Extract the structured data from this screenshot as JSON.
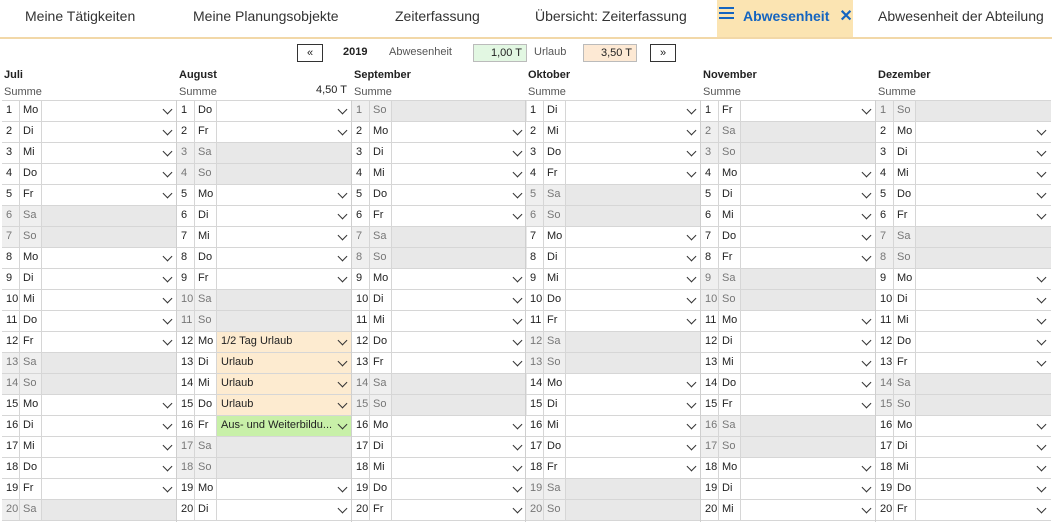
{
  "tabs": [
    {
      "label": "Meine Tätigkeiten"
    },
    {
      "label": "Meine Planungsobjekte"
    },
    {
      "label": "Zeiterfassung"
    },
    {
      "label": "Übersicht: Zeiterfassung"
    },
    {
      "label": "Abwesenheit",
      "active": true
    },
    {
      "label": "Abwesenheit der Abteilung"
    }
  ],
  "controls": {
    "prev": "«",
    "year": "2019",
    "abwesenheit_label": "Abwesenheit",
    "abwesenheit_value": "1,00 T",
    "urlaub_label": "Urlaub",
    "urlaub_value": "3,50 T",
    "next": "»"
  },
  "colors": {
    "accent": "#1565c0",
    "tab_active_bg": "#fbe4b2",
    "urlaub_bg": "#fdebd0",
    "weiter_bg": "#c8f0a8",
    "abw_box": "#e2f7e2",
    "urlaub_box": "#fde9d4"
  },
  "summe_label": "Summe",
  "months": [
    {
      "name": "Juli",
      "summe": "",
      "days": [
        {
          "n": "1",
          "d": "Mo"
        },
        {
          "n": "2",
          "d": "Di"
        },
        {
          "n": "3",
          "d": "Mi"
        },
        {
          "n": "4",
          "d": "Do"
        },
        {
          "n": "5",
          "d": "Fr"
        },
        {
          "n": "6",
          "d": "Sa",
          "we": true
        },
        {
          "n": "7",
          "d": "So",
          "we": true
        },
        {
          "n": "8",
          "d": "Mo"
        },
        {
          "n": "9",
          "d": "Di"
        },
        {
          "n": "10",
          "d": "Mi"
        },
        {
          "n": "11",
          "d": "Do"
        },
        {
          "n": "12",
          "d": "Fr"
        },
        {
          "n": "13",
          "d": "Sa",
          "we": true
        },
        {
          "n": "14",
          "d": "So",
          "we": true
        },
        {
          "n": "15",
          "d": "Mo"
        },
        {
          "n": "16",
          "d": "Di"
        },
        {
          "n": "17",
          "d": "Mi"
        },
        {
          "n": "18",
          "d": "Do"
        },
        {
          "n": "19",
          "d": "Fr"
        },
        {
          "n": "20",
          "d": "Sa",
          "we": true
        }
      ]
    },
    {
      "name": "August",
      "summe": "4,50 T",
      "days": [
        {
          "n": "1",
          "d": "Do"
        },
        {
          "n": "2",
          "d": "Fr"
        },
        {
          "n": "3",
          "d": "Sa",
          "we": true
        },
        {
          "n": "4",
          "d": "So",
          "we": true
        },
        {
          "n": "5",
          "d": "Mo"
        },
        {
          "n": "6",
          "d": "Di"
        },
        {
          "n": "7",
          "d": "Mi"
        },
        {
          "n": "8",
          "d": "Do"
        },
        {
          "n": "9",
          "d": "Fr"
        },
        {
          "n": "10",
          "d": "Sa",
          "we": true
        },
        {
          "n": "11",
          "d": "So",
          "we": true
        },
        {
          "n": "12",
          "d": "Mo",
          "entry": "1/2 Tag Urlaub",
          "kind": "urlaub"
        },
        {
          "n": "13",
          "d": "Di",
          "entry": "Urlaub",
          "kind": "urlaub"
        },
        {
          "n": "14",
          "d": "Mi",
          "entry": "Urlaub",
          "kind": "urlaub"
        },
        {
          "n": "15",
          "d": "Do",
          "entry": "Urlaub",
          "kind": "urlaub"
        },
        {
          "n": "16",
          "d": "Fr",
          "entry": "Aus- und Weiterbildu...",
          "kind": "weiter"
        },
        {
          "n": "17",
          "d": "Sa",
          "we": true
        },
        {
          "n": "18",
          "d": "So",
          "we": true
        },
        {
          "n": "19",
          "d": "Mo"
        },
        {
          "n": "20",
          "d": "Di"
        }
      ]
    },
    {
      "name": "September",
      "summe": "",
      "days": [
        {
          "n": "1",
          "d": "So",
          "we": true
        },
        {
          "n": "2",
          "d": "Mo"
        },
        {
          "n": "3",
          "d": "Di"
        },
        {
          "n": "4",
          "d": "Mi"
        },
        {
          "n": "5",
          "d": "Do"
        },
        {
          "n": "6",
          "d": "Fr"
        },
        {
          "n": "7",
          "d": "Sa",
          "we": true
        },
        {
          "n": "8",
          "d": "So",
          "we": true
        },
        {
          "n": "9",
          "d": "Mo"
        },
        {
          "n": "10",
          "d": "Di"
        },
        {
          "n": "11",
          "d": "Mi"
        },
        {
          "n": "12",
          "d": "Do"
        },
        {
          "n": "13",
          "d": "Fr"
        },
        {
          "n": "14",
          "d": "Sa",
          "we": true
        },
        {
          "n": "15",
          "d": "So",
          "we": true
        },
        {
          "n": "16",
          "d": "Mo"
        },
        {
          "n": "17",
          "d": "Di"
        },
        {
          "n": "18",
          "d": "Mi"
        },
        {
          "n": "19",
          "d": "Do"
        },
        {
          "n": "20",
          "d": "Fr"
        }
      ]
    },
    {
      "name": "Oktober",
      "summe": "",
      "days": [
        {
          "n": "1",
          "d": "Di"
        },
        {
          "n": "2",
          "d": "Mi"
        },
        {
          "n": "3",
          "d": "Do"
        },
        {
          "n": "4",
          "d": "Fr"
        },
        {
          "n": "5",
          "d": "Sa",
          "we": true
        },
        {
          "n": "6",
          "d": "So",
          "we": true
        },
        {
          "n": "7",
          "d": "Mo"
        },
        {
          "n": "8",
          "d": "Di"
        },
        {
          "n": "9",
          "d": "Mi"
        },
        {
          "n": "10",
          "d": "Do"
        },
        {
          "n": "11",
          "d": "Fr"
        },
        {
          "n": "12",
          "d": "Sa",
          "we": true
        },
        {
          "n": "13",
          "d": "So",
          "we": true
        },
        {
          "n": "14",
          "d": "Mo"
        },
        {
          "n": "15",
          "d": "Di"
        },
        {
          "n": "16",
          "d": "Mi"
        },
        {
          "n": "17",
          "d": "Do"
        },
        {
          "n": "18",
          "d": "Fr"
        },
        {
          "n": "19",
          "d": "Sa",
          "we": true
        },
        {
          "n": "20",
          "d": "So",
          "we": true
        }
      ]
    },
    {
      "name": "November",
      "summe": "",
      "days": [
        {
          "n": "1",
          "d": "Fr"
        },
        {
          "n": "2",
          "d": "Sa",
          "we": true
        },
        {
          "n": "3",
          "d": "So",
          "we": true
        },
        {
          "n": "4",
          "d": "Mo"
        },
        {
          "n": "5",
          "d": "Di"
        },
        {
          "n": "6",
          "d": "Mi"
        },
        {
          "n": "7",
          "d": "Do"
        },
        {
          "n": "8",
          "d": "Fr"
        },
        {
          "n": "9",
          "d": "Sa",
          "we": true
        },
        {
          "n": "10",
          "d": "So",
          "we": true
        },
        {
          "n": "11",
          "d": "Mo"
        },
        {
          "n": "12",
          "d": "Di"
        },
        {
          "n": "13",
          "d": "Mi"
        },
        {
          "n": "14",
          "d": "Do"
        },
        {
          "n": "15",
          "d": "Fr"
        },
        {
          "n": "16",
          "d": "Sa",
          "we": true
        },
        {
          "n": "17",
          "d": "So",
          "we": true
        },
        {
          "n": "18",
          "d": "Mo"
        },
        {
          "n": "19",
          "d": "Di"
        },
        {
          "n": "20",
          "d": "Mi"
        }
      ]
    },
    {
      "name": "Dezember",
      "summe": "",
      "days": [
        {
          "n": "1",
          "d": "So",
          "we": true
        },
        {
          "n": "2",
          "d": "Mo"
        },
        {
          "n": "3",
          "d": "Di"
        },
        {
          "n": "4",
          "d": "Mi"
        },
        {
          "n": "5",
          "d": "Do"
        },
        {
          "n": "6",
          "d": "Fr"
        },
        {
          "n": "7",
          "d": "Sa",
          "we": true
        },
        {
          "n": "8",
          "d": "So",
          "we": true
        },
        {
          "n": "9",
          "d": "Mo"
        },
        {
          "n": "10",
          "d": "Di"
        },
        {
          "n": "11",
          "d": "Mi"
        },
        {
          "n": "12",
          "d": "Do"
        },
        {
          "n": "13",
          "d": "Fr"
        },
        {
          "n": "14",
          "d": "Sa",
          "we": true
        },
        {
          "n": "15",
          "d": "So",
          "we": true
        },
        {
          "n": "16",
          "d": "Mo"
        },
        {
          "n": "17",
          "d": "Di"
        },
        {
          "n": "18",
          "d": "Mi"
        },
        {
          "n": "19",
          "d": "Do"
        },
        {
          "n": "20",
          "d": "Fr"
        }
      ]
    }
  ]
}
